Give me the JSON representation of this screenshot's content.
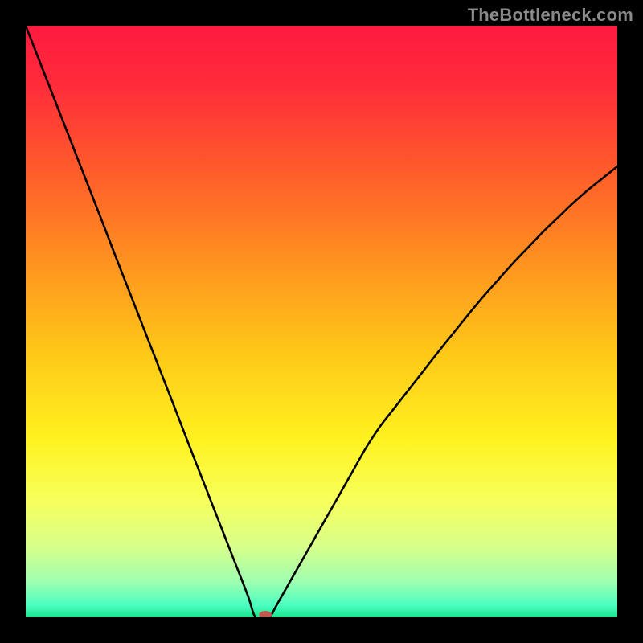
{
  "watermark": {
    "text": "TheBottleneck.com"
  },
  "chart_data": {
    "type": "line",
    "title": "",
    "xlabel": "",
    "ylabel": "",
    "xlim": [
      0,
      100
    ],
    "ylim": [
      0,
      100
    ],
    "x": [
      0,
      2.5,
      5,
      7.5,
      10,
      12.5,
      15,
      17.5,
      20,
      22.5,
      25,
      27.5,
      30,
      32.5,
      35,
      37.5,
      38.8,
      40,
      41.2,
      42.5,
      45,
      47.5,
      50,
      52.5,
      55,
      57.5,
      60,
      62.5,
      65,
      67.5,
      70,
      72.5,
      75,
      77.5,
      80,
      82.5,
      85,
      87.5,
      90,
      92.5,
      95,
      97.5,
      100
    ],
    "values": [
      100,
      93.6,
      87.2,
      80.8,
      74.4,
      68.0,
      61.5,
      55.1,
      48.7,
      42.3,
      35.9,
      29.4,
      23.0,
      16.6,
      10.2,
      3.8,
      0.0,
      0.0,
      0.0,
      2.2,
      6.6,
      11.0,
      15.4,
      19.8,
      24.2,
      28.6,
      32.4,
      35.6,
      38.8,
      42.0,
      45.2,
      48.3,
      51.4,
      54.4,
      57.2,
      60.0,
      62.6,
      65.2,
      67.6,
      70.0,
      72.2,
      74.2,
      76.2
    ],
    "marker": {
      "x": 40.5,
      "y": 0.4
    },
    "legend": [],
    "grid": false
  },
  "gradient": {
    "stops": [
      {
        "offset": 0.0,
        "color": "#ff1a3f"
      },
      {
        "offset": 0.1,
        "color": "#ff2b3a"
      },
      {
        "offset": 0.25,
        "color": "#ff5d2a"
      },
      {
        "offset": 0.4,
        "color": "#ff9220"
      },
      {
        "offset": 0.55,
        "color": "#ffc718"
      },
      {
        "offset": 0.7,
        "color": "#fff220"
      },
      {
        "offset": 0.8,
        "color": "#f8ff5a"
      },
      {
        "offset": 0.88,
        "color": "#d8ff8a"
      },
      {
        "offset": 0.94,
        "color": "#9effb0"
      },
      {
        "offset": 0.98,
        "color": "#4bffc0"
      },
      {
        "offset": 1.0,
        "color": "#16e58e"
      }
    ]
  },
  "marker_style": {
    "fill": "#c05a50",
    "rx": 8,
    "ry": 5
  }
}
